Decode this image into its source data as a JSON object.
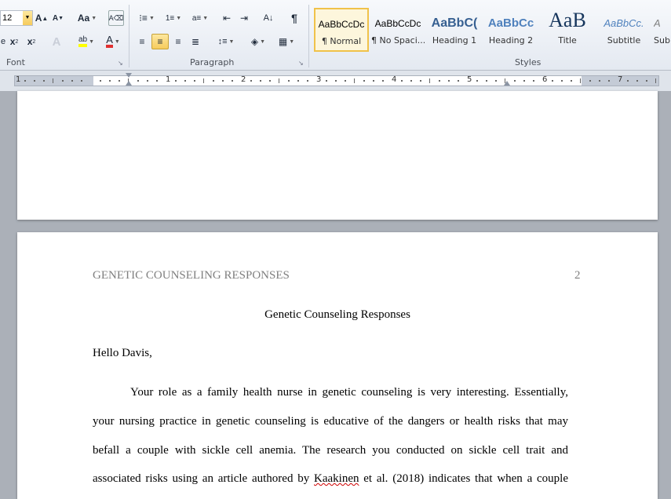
{
  "ribbon": {
    "font_size": "12",
    "font_group_label": "Font",
    "paragraph_group_label": "Paragraph",
    "styles_group_label": "Styles",
    "styles": [
      {
        "sample": "AaBbCcDc",
        "name": "¶ Normal",
        "selected": true
      },
      {
        "sample": "AaBbCcDc",
        "name": "¶ No Spaci...",
        "selected": false
      },
      {
        "sample": "AaBbC(",
        "name": "Heading 1",
        "selected": false
      },
      {
        "sample": "AaBbCc",
        "name": "Heading 2",
        "selected": false
      },
      {
        "sample": "AaB",
        "name": "Title",
        "selected": false
      },
      {
        "sample": "AaBbCc.",
        "name": "Subtitle",
        "selected": false
      },
      {
        "sample": "A",
        "name": "Sub",
        "selected": false
      }
    ]
  },
  "ruler": {
    "numbers": [
      "1",
      "1",
      "2",
      "3",
      "4",
      "5",
      "6",
      "7"
    ]
  },
  "document": {
    "running_head": "GENETIC COUNSELING RESPONSES",
    "page_number": "2",
    "title": "Genetic Counseling Responses",
    "greeting": "Hello Davis,",
    "lines": [
      "Your role as a family health nurse in genetic counseling is very interesting. Essentially,",
      "your nursing practice in genetic counseling is educative of the dangers or health risks that may",
      "befall a couple with sickle cell anemia. The research you conducted on sickle cell trait and"
    ],
    "last_line_before": "associated risks using an article authored by ",
    "last_line_flagged": "Kaakinen",
    "last_line_after": " et al. (2018) indicates that when a couple"
  },
  "colors": {
    "ribbon_bg": "#e4e9f1",
    "selected_style": "#f0c24a",
    "heading_blue": "#365f91",
    "running_head_gray": "#7f7f7f",
    "spell_error": "#d00000"
  }
}
